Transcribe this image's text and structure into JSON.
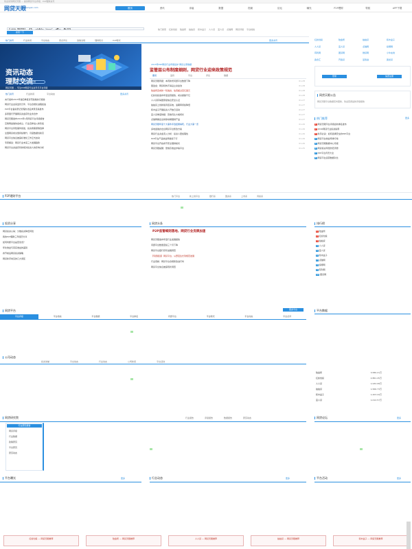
{
  "header": {
    "top_notice": "欢迎来到网贷天眼 — 提供网贷平台评级、P2P理财资讯",
    "logo": "网贷天眼",
    "slogan": "Wdtianyan.com"
  },
  "nav": {
    "items": [
      {
        "label": "首页",
        "active": true
      },
      {
        "label": "资讯"
      },
      {
        "label": "评级"
      },
      {
        "label": "数据"
      },
      {
        "label": "档案"
      },
      {
        "label": "论坛"
      },
      {
        "label": "曝光"
      },
      {
        "label": "P2P理财"
      },
      {
        "label": "导航"
      },
      {
        "label": "APP下载"
      }
    ]
  },
  "search": {
    "placeholder": "请输入平台名称",
    "button": "搜索一下",
    "hotwords": [
      "热门搜索",
      "红岭创投",
      "陆金所",
      "拍拍贷",
      "积木盒子",
      "人人贷",
      "宜人贷",
      "点融网",
      "网贷评级",
      "平台档案"
    ]
  },
  "news": {
    "tabs": [
      "热门资讯",
      "行业新闻",
      "平台动态",
      "观点评论",
      "政策法规",
      "理财知识",
      "P2P曝光"
    ],
    "more": "更多资讯",
    "banner_line1": "资讯动态",
    "banner_line2": "理财交流",
    "banner_pill": "尽在网贷天眼",
    "banner_caption": "网贷天眼 — 专注P2P网贷行业资讯与平台评级",
    "sub": "2015年P2P网贷行业年报出炉 网贷之家数据",
    "headline": "监管层公布制度细则，网贷行业迎来政策规范",
    "headline_tabs": [
      "要闻",
      "监管",
      "平台",
      "评论",
      "数据"
    ],
    "left_list": [
      "央行发布2015年第四季度货币政策执行报告",
      "网贷行业迎来监管元年，平台合规化进程加速",
      "P2P平台备案登记管理办法征求意见稿发布",
      "多家银行开展网贷资金存管业务合作",
      "网贷天眼发布2016年1月网贷平台评级报告",
      "互联网金融协会成立，行业自律进入新阶段",
      "网贷平台风险事件频发，投资者需谨慎选择",
      "全国网贷成交量持续攀升，月度数据创新高",
      "网贷平台信息披露标准化工作正式启动",
      "专家解读：网贷行业未来三大发展趋势",
      "网贷平台资金存管新规对投资人的影响分析"
    ],
    "mid_list": [
      {
        "t": "网贷天眼周报：本周新增问题平台数量下降",
        "d": "01-28"
      },
      {
        "t": "银监会：网贷机构不得设立资金池",
        "d": "01-28"
      },
      {
        "t": "陆金所完成新一轮融资，估值超过百亿美元",
        "d": "01-28",
        "c": "red"
      },
      {
        "t": "红岭创投发布年度运营报告，成交额破千亿",
        "d": "01-28"
      },
      {
        "t": "人人贷获得国家级信息安全认证",
        "d": "01-27"
      },
      {
        "t": "拍拍贷上线新版风控系统，逾期率持续降低",
        "d": "01-27"
      },
      {
        "t": "积木盒子开展投资人开放日活动",
        "d": "01-27"
      },
      {
        "t": "宜人贷季度财报：营收同比大幅增长",
        "d": "01-27"
      },
      {
        "t": "点融网推出全新移动端理财产品",
        "d": "01-27"
      },
      {
        "t": "网贷天眼年度十大事件评选结果揭晓，行业大事一览",
        "d": "01-26",
        "c": "blue"
      },
      {
        "t": "多地金融办出台网贷平台整改方案",
        "d": "01-26"
      },
      {
        "t": "网贷行业资金流入分析：投资人更加理性",
        "d": "01-26"
      },
      {
        "t": "P2P平台产品收益率继续下行",
        "d": "01-26"
      },
      {
        "t": "网贷平台开启春节安全理财模式",
        "d": "01-26"
      },
      {
        "t": "网贷天眼提醒：警惕高收益诈骗平台",
        "d": "01-25"
      }
    ]
  },
  "sidebar": {
    "platform_links": [
      "红岭创投",
      "陆金所",
      "拍拍贷",
      "积木盒子",
      "人人贷",
      "宜人贷",
      "点融网",
      "投哪网",
      "有利网",
      "团贷网",
      "微贷网",
      "小牛在线",
      "鑫合汇",
      "开鑫贷",
      "爱钱进",
      "翼龙贷"
    ],
    "login_button": "登录",
    "register_button": "免费注册",
    "notice_title": "网贷天眼公告",
    "notice": "网贷天眼平台数据实时更新，欢迎查阅最新评级报告",
    "hot_title": "热门推荐",
    "hot_more": "更多",
    "hot_list": [
      "网贷天眼平台评级最新排名发布",
      "2016网贷行业投资指南",
      "新手必读：如何选择安全的P2P平台",
      "网贷平台收益率排行榜",
      "网贷天眼数据中心月报",
      "网贷投资风险防范手册",
      "P2P平台背景大全",
      "网贷平台运营数据对比"
    ]
  },
  "section_p2p": {
    "title": "P2P理财平台",
    "tabs": [
      "热门平台",
      "新上线平台",
      "银行系",
      "国资系",
      "上市系",
      "风投系"
    ]
  },
  "section_opinion": {
    "title": "投资分享",
    "list": [
      "网贷投资心得：分散投资降低风险",
      "我的P2P理财三年经历分享",
      "如何判断平台是否靠谱？",
      "年化收益与真实收益的差别",
      "春节前后网贷投资策略",
      "网贷新手常见的几大误区"
    ]
  },
  "section_headline2": {
    "title": "网贷头条",
    "headline": "P2P监管细则落地，网贷行业洗牌加速",
    "list": [
      "网贷天眼发布年度行业发展报告",
      "问题平台数量连续三个月下降",
      "网贷平台银行存管进展调查",
      "【专题报道】网贷平台，从野蛮生长到规范发展",
      "行业观察：网贷平台合规整改进行时",
      "网贷平台信息披露现状调查"
    ]
  },
  "section_rank": {
    "title": "排行榜",
    "list": [
      "陆金所",
      "红岭创投",
      "拍拍贷",
      "人人贷",
      "宜人贷",
      "积木盒子",
      "点融网",
      "投哪网",
      "有利网",
      "团贷网"
    ]
  },
  "section_platform": {
    "title": "网贷平台",
    "more": "更多平台",
    "tabs": [
      "平台评级",
      "平台档案",
      "平台数据",
      "平台排名",
      "问题平台",
      "平台曝光",
      "平台动态",
      "平台点评"
    ]
  },
  "section_stats": {
    "title": "平台数据",
    "rows": [
      {
        "name": "陆金所",
        "v": "3,580.21万"
      },
      {
        "name": "红岭创投",
        "v": "2,861.45万"
      },
      {
        "name": "人人贷",
        "v": "1,932.08万"
      },
      {
        "name": "拍拍贷",
        "v": "1,566.73万"
      },
      {
        "name": "积木盒子",
        "v": "1,203.44万"
      },
      {
        "name": "宜人贷",
        "v": "1,012.57万"
      }
    ]
  },
  "section_company": {
    "title": "公司动态",
    "tabs": [
      "投资讲堂",
      "平台动态",
      "行业动态",
      "公司新闻",
      "平台活动"
    ]
  },
  "section_research": {
    "title": "网贷研究院",
    "menu": [
      "行业研究报告",
      "网贷评级",
      "行业数据",
      "政策研究",
      "平台研究",
      "研究动态"
    ],
    "tabs": [
      "行业报告",
      "评级报告",
      "数据报告",
      "研究动态"
    ]
  },
  "section_forum": {
    "title": "网贷论坛",
    "more": "更多"
  },
  "bottom_sections": [
    {
      "title": "平台曝光",
      "more": "更多"
    },
    {
      "title": "行业动态",
      "more": "更多"
    },
    {
      "title": "平台活动",
      "more": "更多"
    }
  ],
  "bottom_links": [
    {
      "label": "红岭创投 — 网贷天眼推荐"
    },
    {
      "label": "陆金所 — 网贷天眼推荐"
    },
    {
      "label": "人人贷 — 网贷天眼推荐"
    },
    {
      "label": "拍拍贷 — 网贷天眼推荐"
    },
    {
      "label": "积木盒子 — 网贷天眼推荐"
    }
  ],
  "colors": {
    "accent": "#2a8fe0",
    "headline": "#b01e1e",
    "banner": "#1e5aa8"
  }
}
